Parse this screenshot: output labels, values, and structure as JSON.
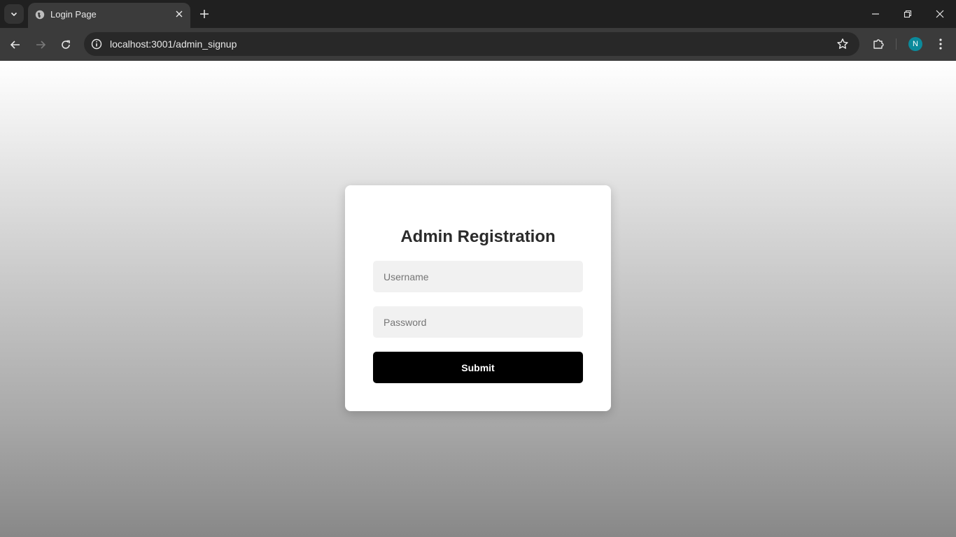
{
  "browser": {
    "tab_title": "Login Page",
    "url": "localhost:3001/admin_signup",
    "profile_initial": "N",
    "profile_color": "#0b8a9b"
  },
  "page": {
    "title": "Admin Registration",
    "username_placeholder": "Username",
    "password_placeholder": "Password",
    "submit_label": "Submit",
    "submit_color": "#000000"
  }
}
